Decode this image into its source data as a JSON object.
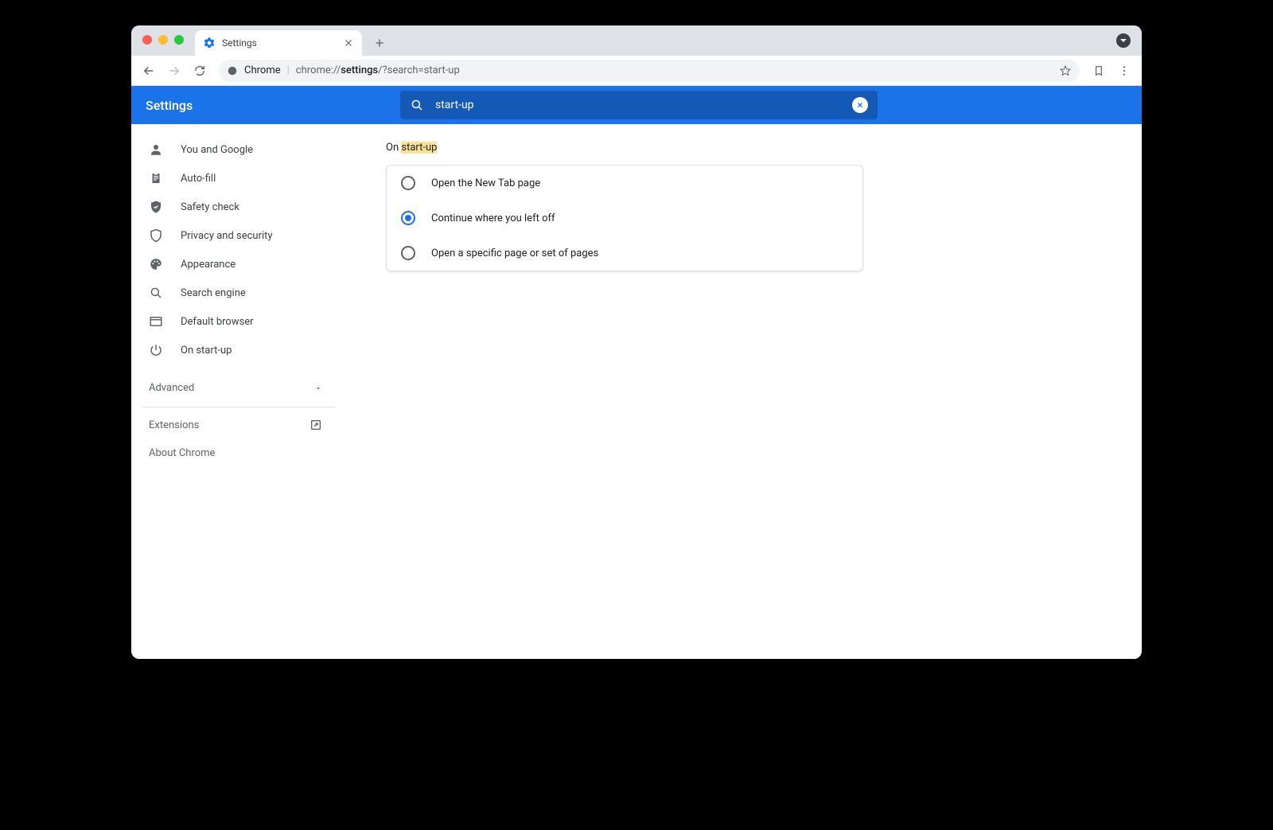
{
  "tab": {
    "title": "Settings"
  },
  "omnibox": {
    "scheme_host": "Chrome",
    "sep": " | ",
    "prefix": "chrome://",
    "bold": "settings",
    "suffix": "/?search=start-up"
  },
  "header": {
    "title": "Settings",
    "search_value": "start-up"
  },
  "sidebar": {
    "items": [
      {
        "label": "You and Google"
      },
      {
        "label": "Auto-fill"
      },
      {
        "label": "Safety check"
      },
      {
        "label": "Privacy and security"
      },
      {
        "label": "Appearance"
      },
      {
        "label": "Search engine"
      },
      {
        "label": "Default browser"
      },
      {
        "label": "On start-up"
      }
    ],
    "advanced_label": "Advanced",
    "extensions_label": "Extensions",
    "about_label": "About Chrome"
  },
  "main": {
    "title_prefix": "On ",
    "title_highlight": "start-up",
    "options": [
      {
        "label": "Open the New Tab page",
        "selected": false
      },
      {
        "label": "Continue where you left off",
        "selected": true
      },
      {
        "label": "Open a specific page or set of pages",
        "selected": false
      }
    ]
  }
}
